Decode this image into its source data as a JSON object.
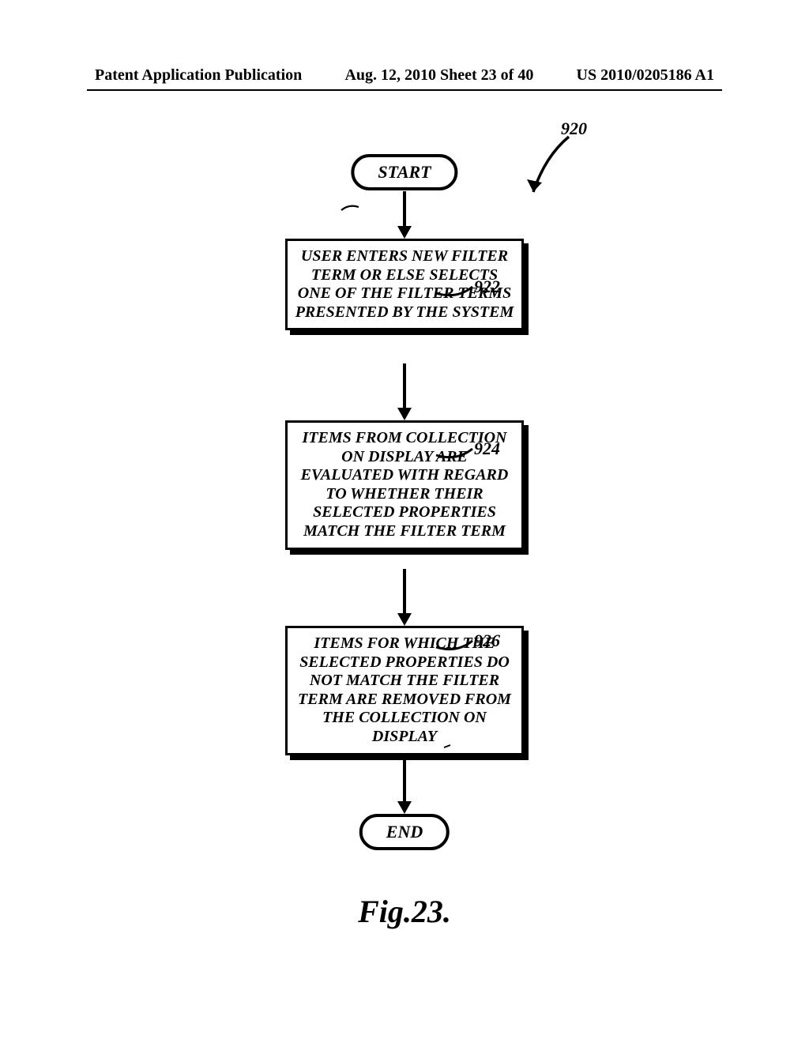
{
  "header": {
    "left": "Patent Application Publication",
    "center": "Aug. 12, 2010  Sheet 23 of 40",
    "right": "US 2010/0205186 A1"
  },
  "figure_ref": "920",
  "steps": {
    "start": "START",
    "s922": "USER ENTERS NEW FILTER TERM OR ELSE SELECTS ONE OF THE FILTER TERMS PRESENTED BY THE SYSTEM",
    "s924": "ITEMS FROM COLLECTION ON DISPLAY ARE EVALUATED WITH REGARD TO WHETHER THEIR SELECTED PROPERTIES MATCH THE FILTER TERM",
    "s926": "ITEMS FOR WHICH THE SELECTED PROPERTIES DO NOT MATCH THE FILTER TERM ARE REMOVED FROM THE COLLECTION ON DISPLAY",
    "end": "END"
  },
  "labels": {
    "l922": "922",
    "l924": "924",
    "l926": "926"
  },
  "figure_caption": "Fig.23."
}
